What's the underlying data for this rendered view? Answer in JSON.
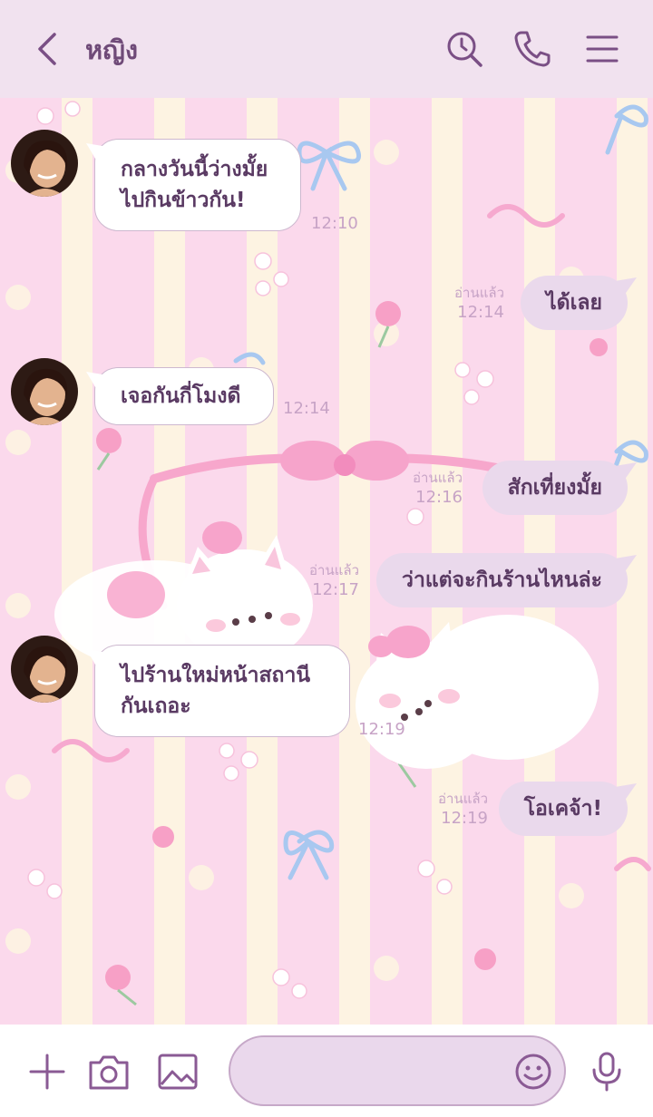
{
  "header": {
    "title": "หญิง",
    "icons": [
      "back-chevron-icon",
      "history-search-icon",
      "phone-icon",
      "menu-icon"
    ]
  },
  "colors": {
    "accent": "#8a5a94",
    "header_bg": "#f1e2ef",
    "bubble_out": "#ead9ec",
    "text": "#5a3a63"
  },
  "messages": [
    {
      "side": "in",
      "text_lines": [
        "กลางวันนี้ว่างมั้ย",
        "ไปกินข้าวกัน!"
      ],
      "time": "12:10"
    },
    {
      "side": "out",
      "text": "ได้เลย",
      "read": "อ่านแล้ว",
      "time": "12:14"
    },
    {
      "side": "in",
      "text": "เจอกันกี่โมงดี",
      "time": "12:14"
    },
    {
      "side": "out",
      "text": "สักเที่ยงมั้ย",
      "read": "อ่านแล้ว",
      "time": "12:16"
    },
    {
      "side": "out",
      "text": "ว่าแต่จะกินร้านไหนล่ะ",
      "read": "อ่านแล้ว",
      "time": "12:17"
    },
    {
      "side": "in",
      "text_lines": [
        "ไปร้านใหม่หน้าสถานี",
        "กันเถอะ"
      ],
      "time": "12:19"
    },
    {
      "side": "out",
      "text": "โอเคจ้า!",
      "read": "อ่านแล้ว",
      "time": "12:19"
    }
  ],
  "footer": {
    "icons": [
      "plus-icon",
      "camera-icon",
      "image-icon",
      "emoji-icon",
      "microphone-icon"
    ],
    "input_placeholder": ""
  }
}
